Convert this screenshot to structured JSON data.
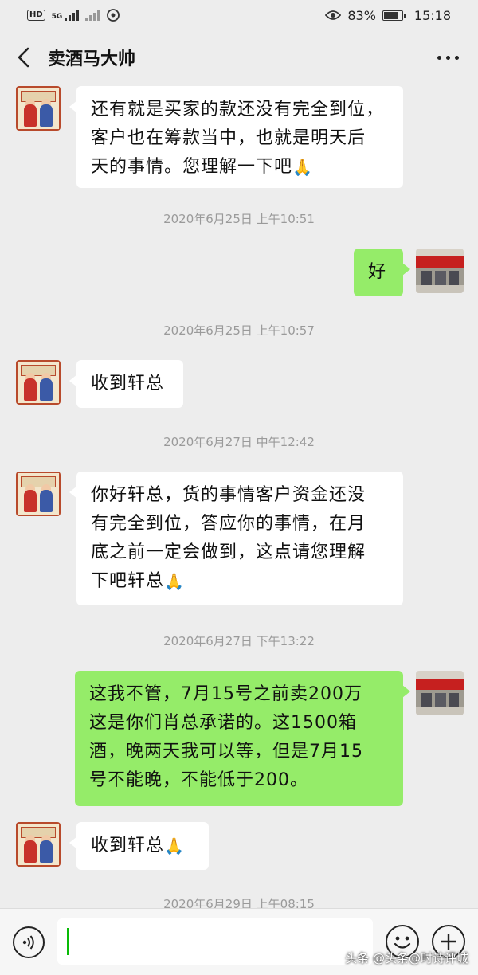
{
  "status_bar": {
    "hd": "HD",
    "net": "5G",
    "battery_percent": "83%",
    "battery_level": 0.83,
    "time": "15:18"
  },
  "header": {
    "title": "卖酒马大帅",
    "back_icon": "chevron-left-icon",
    "more_icon": "more-dots-icon"
  },
  "messages": [
    {
      "side": "in",
      "lines": [
        "还有就是买家的款还没有完全到位，",
        "客户也在筹款当中，也就是明天后",
        "天的事情。您理解一下吧"
      ],
      "emoji": "🙏"
    },
    {
      "timestamp": "2020年6月25日 上午10:51"
    },
    {
      "side": "out",
      "lines": [
        "好"
      ]
    },
    {
      "timestamp": "2020年6月25日 上午10:57"
    },
    {
      "side": "in",
      "lines": [
        "收到轩总"
      ]
    },
    {
      "timestamp": "2020年6月27日 中午12:42"
    },
    {
      "side": "in",
      "lines": [
        "你好轩总，货的事情客户资金还没",
        "有完全到位，答应你的事情，在月",
        "底之前一定会做到，这点请您理解",
        "下吧轩总"
      ],
      "emoji": "🙏"
    },
    {
      "timestamp": "2020年6月27日 下午13:22"
    },
    {
      "side": "out",
      "lines": [
        "这我不管，7月15号之前卖200万",
        "这是你们肖总承诺的。这1500箱",
        "酒，晚两天我可以等，但是7月15",
        "号不能晚，不能低于200。"
      ]
    },
    {
      "side": "in",
      "lines": [
        "收到轩总"
      ],
      "emoji": "🙏"
    },
    {
      "timestamp": "2020年6月29日 上午08:15"
    }
  ],
  "input_bar": {
    "voice_icon": "voice-icon",
    "emoji_icon": "emoji-icon",
    "plus_icon": "plus-icon",
    "input_value": ""
  },
  "watermark": "头条 @头条@时诗评城"
}
